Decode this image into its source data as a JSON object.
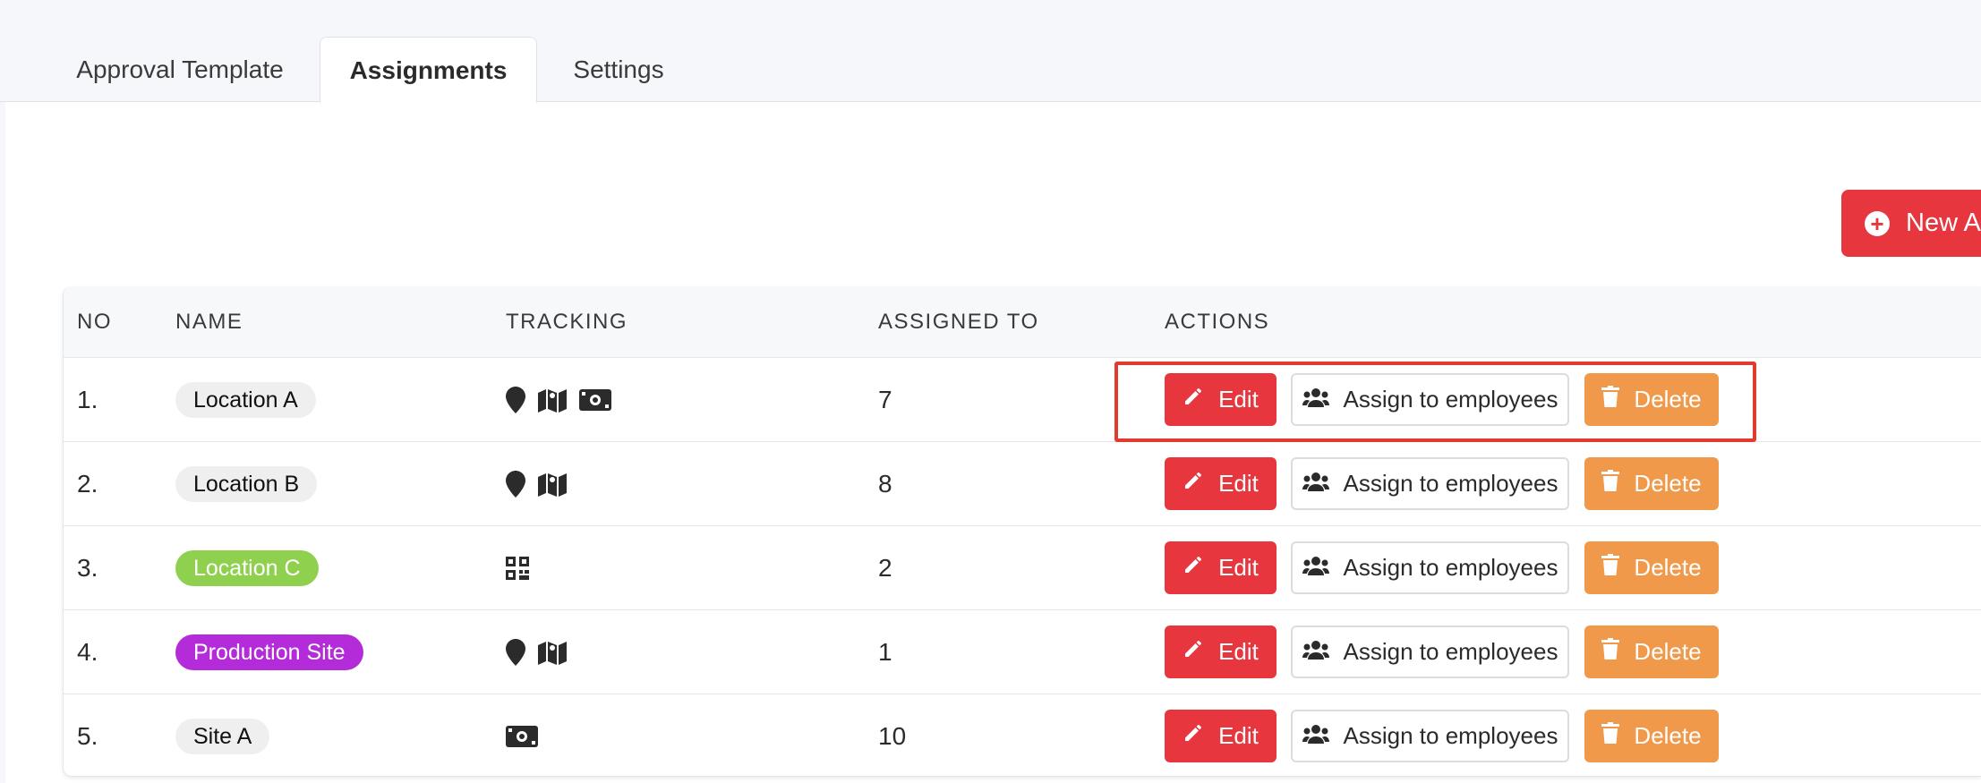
{
  "tabs": [
    {
      "label": "Approval Template",
      "active": false
    },
    {
      "label": "Assignments",
      "active": true
    },
    {
      "label": "Settings",
      "active": false
    }
  ],
  "new_button": {
    "label": "New As"
  },
  "table": {
    "headers": {
      "no": "NO",
      "name": "NAME",
      "tracking": "TRACKING",
      "assigned_to": "ASSIGNED TO",
      "actions": "ACTIONS"
    },
    "rows": [
      {
        "no": "1.",
        "name": "Location A",
        "pill_color": "#efefef",
        "pill_text_color": "#111111",
        "tracking": [
          "location-pin-icon",
          "map-icon",
          "money-icon"
        ],
        "assigned": "7"
      },
      {
        "no": "2.",
        "name": "Location B",
        "pill_color": "#efefef",
        "pill_text_color": "#111111",
        "tracking": [
          "location-pin-icon",
          "map-icon"
        ],
        "assigned": "8"
      },
      {
        "no": "3.",
        "name": "Location C",
        "pill_color": "#8fd14f",
        "pill_text_color": "#ffffff",
        "tracking": [
          "qr-code-icon"
        ],
        "assigned": "2"
      },
      {
        "no": "4.",
        "name": "Production Site",
        "pill_color": "#b42bd9",
        "pill_text_color": "#ffffff",
        "tracking": [
          "location-pin-icon",
          "map-icon"
        ],
        "assigned": "1"
      },
      {
        "no": "5.",
        "name": "Site A",
        "pill_color": "#efefef",
        "pill_text_color": "#111111",
        "tracking": [
          "money-icon"
        ],
        "assigned": "10"
      }
    ]
  },
  "actions": {
    "edit": "Edit",
    "assign": "Assign to employees",
    "delete": "Delete"
  },
  "colors": {
    "accent_red": "#e8363f",
    "delete_orange": "#f0994a",
    "highlight_border": "#e23a2d"
  }
}
